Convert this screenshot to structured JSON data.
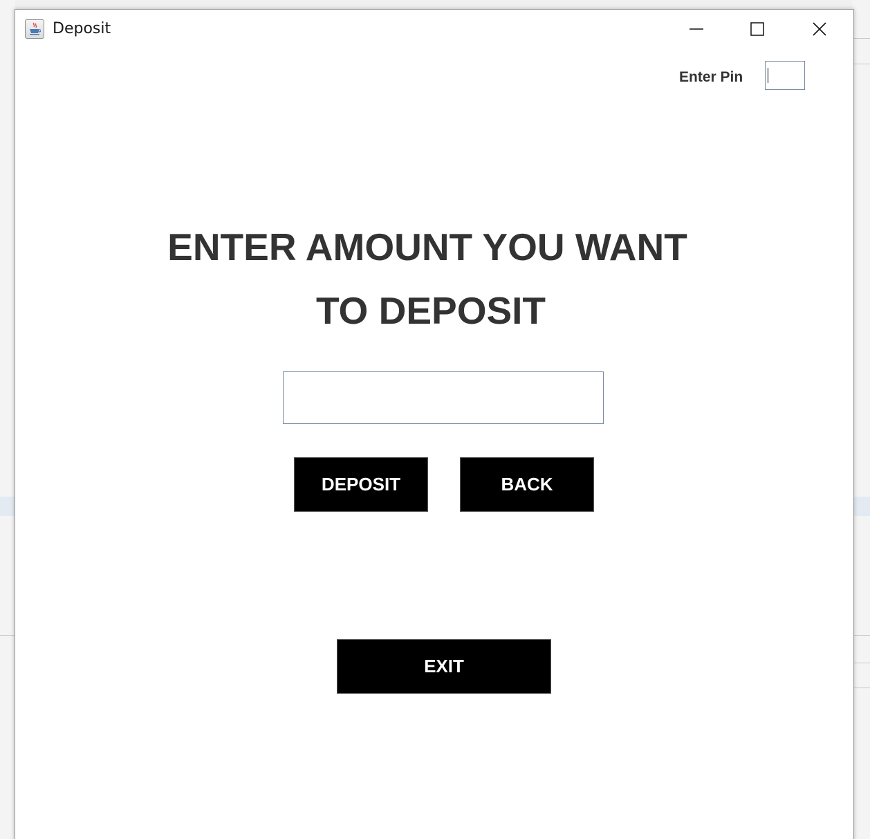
{
  "window": {
    "title": "Deposit",
    "icon": "java-cup-icon",
    "controls": {
      "minimize": "minimize-icon",
      "maximize": "maximize-icon",
      "close": "close-icon"
    }
  },
  "pin": {
    "label": "Enter Pin",
    "value": ""
  },
  "heading": {
    "line1": "ENTER AMOUNT YOU WANT",
    "line2": "TO DEPOSIT"
  },
  "amount": {
    "value": ""
  },
  "buttons": {
    "deposit": "DEPOSIT",
    "back": "BACK",
    "exit": "EXIT"
  },
  "colors": {
    "button_bg": "#000000",
    "button_text": "#ffffff",
    "heading_text": "#333333"
  }
}
